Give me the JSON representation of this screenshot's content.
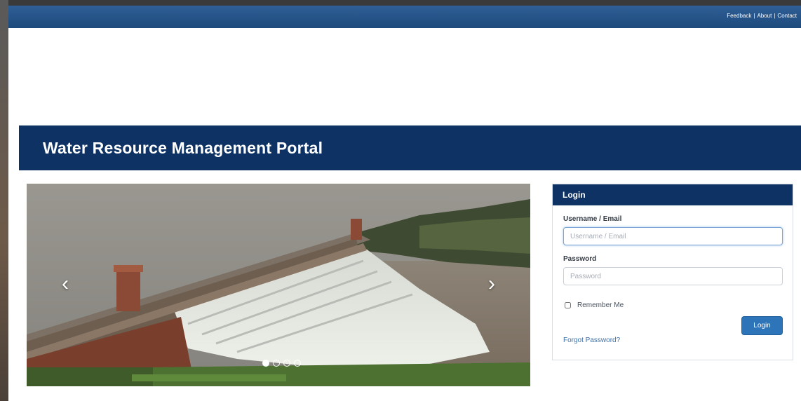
{
  "header": {
    "links": [
      "Feedback",
      "About",
      "Contact"
    ]
  },
  "portal": {
    "title": "Water Resource Management Portal"
  },
  "carousel": {
    "image_subject": "dam spillway with water flowing",
    "prev_icon": "chevron-left-icon",
    "next_icon": "chevron-right-icon",
    "slide_count": 4,
    "active_index": 0
  },
  "login": {
    "title": "Login",
    "username_label": "Username / Email",
    "username_placeholder": "Username / Email",
    "password_label": "Password",
    "password_placeholder": "Password",
    "remember_label": "Remember Me",
    "button_label": "Login",
    "forgot_label": "Forgot Password?"
  },
  "colors": {
    "topbar": "#1e4a7c",
    "titlebar": "#0d3263",
    "button": "#2d74b8",
    "link": "#3d6fa6"
  }
}
